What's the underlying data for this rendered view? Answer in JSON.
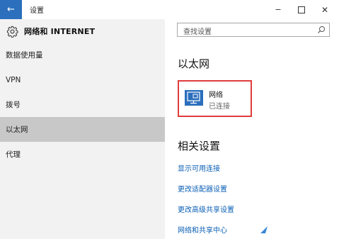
{
  "titlebar": {
    "back_glyph": "←",
    "title": "设置",
    "minimize_glyph": "−",
    "close_glyph": "✕"
  },
  "sidebar": {
    "header_title": "网络和 INTERNET",
    "items": [
      {
        "label": "数据使用量",
        "active": false
      },
      {
        "label": "VPN",
        "active": false
      },
      {
        "label": "拨号",
        "active": false
      },
      {
        "label": "以太网",
        "active": true
      },
      {
        "label": "代理",
        "active": false
      }
    ]
  },
  "search": {
    "placeholder": "查找设置",
    "icon": "search-icon"
  },
  "main": {
    "section_title": "以太网",
    "network": {
      "name": "网络",
      "status": "已连接",
      "icon": "ethernet-monitor-icon"
    },
    "related_title": "相关设置",
    "links": [
      "显示可用连接",
      "更改适配器设置",
      "更改高级共享设置",
      "网络和共享中心"
    ]
  },
  "colors": {
    "accent": "#2b6fbd",
    "link": "#0b5fb5",
    "highlight_border": "#e03c3c",
    "sidebar_bg": "#f2f2f2",
    "active_item_bg": "#c8c8c8"
  }
}
